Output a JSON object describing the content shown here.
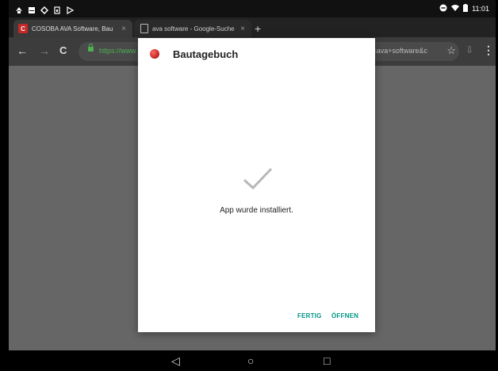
{
  "statusbar": {
    "icons": [
      "notification-icon",
      "message-icon",
      "bug-icon",
      "sim-icon",
      "play-store-icon"
    ],
    "right_icons": [
      "minus-circle-icon",
      "wifi-icon",
      "battery-icon"
    ],
    "time": "11:01"
  },
  "tabs": [
    {
      "title": "COSOBA AVA Software, Bau",
      "close": "×",
      "icon": "cosoba-favicon"
    },
    {
      "title": "ava software - Google-Suche",
      "close": "×",
      "icon": "document-icon"
    }
  ],
  "new_tab": "+",
  "toolbar": {
    "back": "←",
    "forward": "→",
    "reload": "C",
    "url_left": "https://www",
    "url_right": "&q=ava+software&c",
    "bookmark": "☆",
    "download": "⇩",
    "menu": "⋮"
  },
  "dialog": {
    "title": "Bautagebuch",
    "message": "App wurde installiert.",
    "fertig": "FERTIG",
    "offnen": "ÖFFNEN",
    "accent": "#009688"
  },
  "navbar": {
    "back": "◁",
    "home": "○",
    "recents": "□"
  }
}
